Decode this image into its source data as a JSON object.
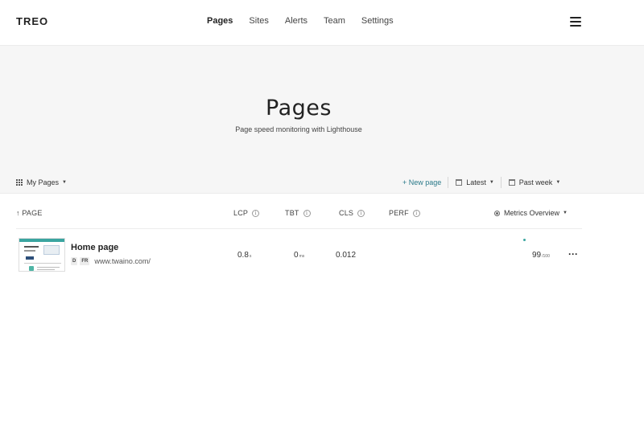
{
  "header": {
    "logo": "TREO",
    "nav": [
      "Pages",
      "Sites",
      "Alerts",
      "Team",
      "Settings"
    ],
    "active_nav": "Pages"
  },
  "hero": {
    "title": "Pages",
    "subtitle": "Page speed monitoring with Lighthouse"
  },
  "toolbar": {
    "scope_label": "My Pages",
    "new_page_label": "+ New page",
    "version_label": "Latest",
    "period_label": "Past week"
  },
  "table": {
    "columns": {
      "page": "↑ PAGE",
      "lcp": "LCP",
      "tbt": "TBT",
      "cls": "CLS",
      "perf": "PERF"
    },
    "metrics_dropdown": "Metrics Overview",
    "rows": [
      {
        "name": "Home page",
        "tags": [
          "D",
          "FR"
        ],
        "url": "www.twaino.com/",
        "lcp": "0.8",
        "lcp_unit": "s",
        "tbt": "0",
        "tbt_unit": "ms",
        "cls": "0.012",
        "score": "99",
        "score_unit": "/100"
      }
    ]
  },
  "colors": {
    "accent": "#2b7a8a",
    "perf_dot": "#3aa5a0",
    "hero_bg": "#f6f6f6"
  }
}
